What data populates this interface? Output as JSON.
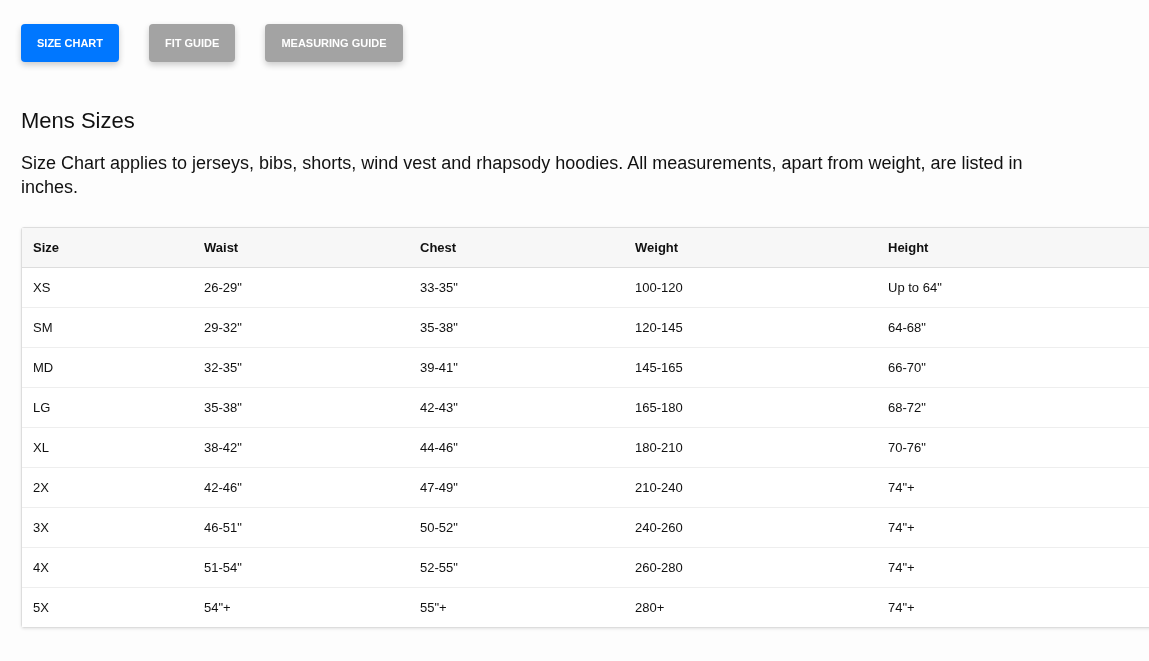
{
  "tabs": [
    {
      "label": "SIZE CHART",
      "selected": true
    },
    {
      "label": "FIT GUIDE",
      "selected": false
    },
    {
      "label": "MEASURING GUIDE",
      "selected": false
    }
  ],
  "heading": "Mens Sizes",
  "description": "Size Chart applies to jerseys, bibs, shorts, wind vest and rhapsody hoodies. All measurements, apart from weight, are listed in inches.",
  "table": {
    "columns": [
      "Size",
      "Waist",
      "Chest",
      "Weight",
      "Height"
    ],
    "rows": [
      [
        "XS",
        "26-29\"",
        "33-35\"",
        "100-120",
        "Up to 64\""
      ],
      [
        "SM",
        "29-32\"",
        "35-38\"",
        "120-145",
        "64-68\""
      ],
      [
        "MD",
        "32-35\"",
        "39-41\"",
        "145-165",
        "66-70\""
      ],
      [
        "LG",
        "35-38\"",
        "42-43\"",
        "165-180",
        "68-72\""
      ],
      [
        "XL",
        "38-42\"",
        "44-46\"",
        "180-210",
        "70-76\""
      ],
      [
        "2X",
        "42-46\"",
        "47-49\"",
        "210-240",
        "74\"+"
      ],
      [
        "3X",
        "46-51\"",
        "50-52\"",
        "240-260",
        "74\"+"
      ],
      [
        "4X",
        "51-54\"",
        "52-55\"",
        "260-280",
        "74\"+"
      ],
      [
        "5X",
        "54\"+",
        "55\"+",
        "280+",
        "74\"+"
      ]
    ]
  }
}
